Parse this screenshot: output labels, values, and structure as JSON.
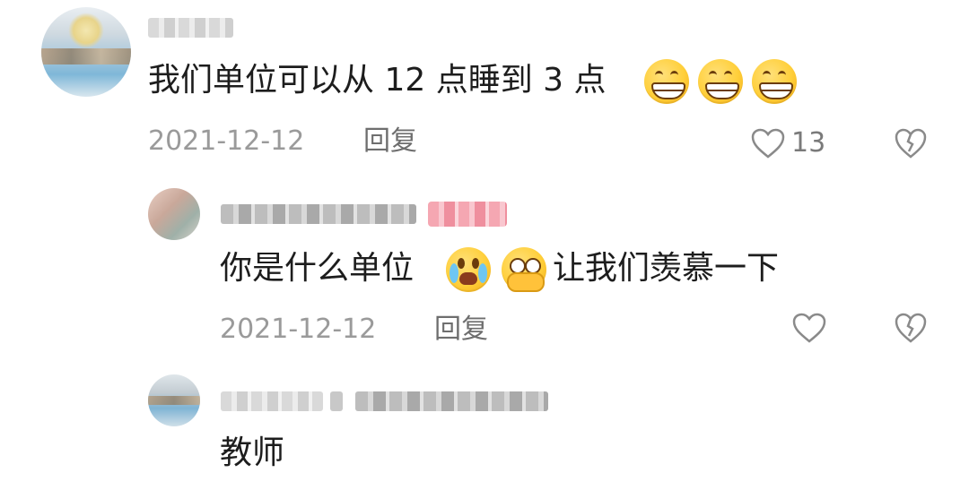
{
  "comments": [
    {
      "text": "我们单位可以从 12 点睡到 3 点",
      "date": "2021-12-12",
      "reply_label": "回复",
      "like_count": "13",
      "emojis": [
        "grin-emoji",
        "grin-emoji",
        "grin-emoji"
      ]
    },
    {
      "text_before": "你是什么单位",
      "text_after": "让我们羡慕一下",
      "date": "2021-12-12",
      "reply_label": "回复",
      "emojis": [
        "crying-emoji",
        "pleading-emoji"
      ]
    },
    {
      "text": "教师"
    }
  ],
  "icons": {
    "like": "heart-outline-icon",
    "dislike": "broken-heart-icon"
  },
  "colors": {
    "text": "#1d1d1d",
    "meta": "#9a9a9a",
    "icon_stroke": "#8a8a8a",
    "author_badge": "#f5a7b2"
  }
}
